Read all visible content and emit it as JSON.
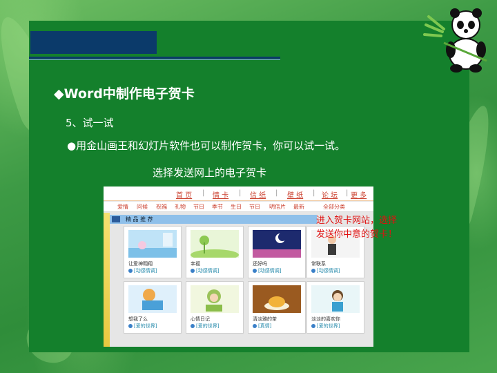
{
  "slide": {
    "heading": "◆Word中制作电子贺卡",
    "step": "5、试一试",
    "bullet": "●用金山画王和幻灯片软件也可以制作贺卡，你可以试一试。",
    "caption": "选择发送网上的电子贺卡",
    "note_line1": "进入贺卡网站，选择",
    "note_line2": "发送你中意的贺卡！"
  },
  "screenshot": {
    "nav_main": [
      "首 页",
      "|",
      "情 卡",
      "|",
      "信 纸",
      "|",
      "壁 纸",
      "|",
      "论 坛",
      "|",
      "更 多"
    ],
    "nav_sub": [
      "爱情",
      "问候",
      "祝福",
      "礼物",
      "节日",
      "季节",
      "生日",
      "节日",
      "明信片",
      "最新",
      "全部分类"
    ],
    "section_label": "精 品 推 荐",
    "cards": [
      {
        "title": "让爱神翱翔",
        "tag": "[动感情调]"
      },
      {
        "title": "幸福",
        "tag": "[动感情调]"
      },
      {
        "title": "还好吗",
        "tag": "[动感情调]"
      },
      {
        "title": "常联系",
        "tag": "[动感情调]"
      },
      {
        "title": "想我了么",
        "tag": "[爱的世界]"
      },
      {
        "title": "心情日记",
        "tag": "[爱的世界]"
      },
      {
        "title": "清淡雅的茶",
        "tag": "[真情]"
      },
      {
        "title": "淡淡的喜欢你",
        "tag": "[爱的世界]"
      }
    ]
  },
  "colors": {
    "panel": "#14802c",
    "title_block": "#0b3a6a",
    "note": "#e01010"
  }
}
